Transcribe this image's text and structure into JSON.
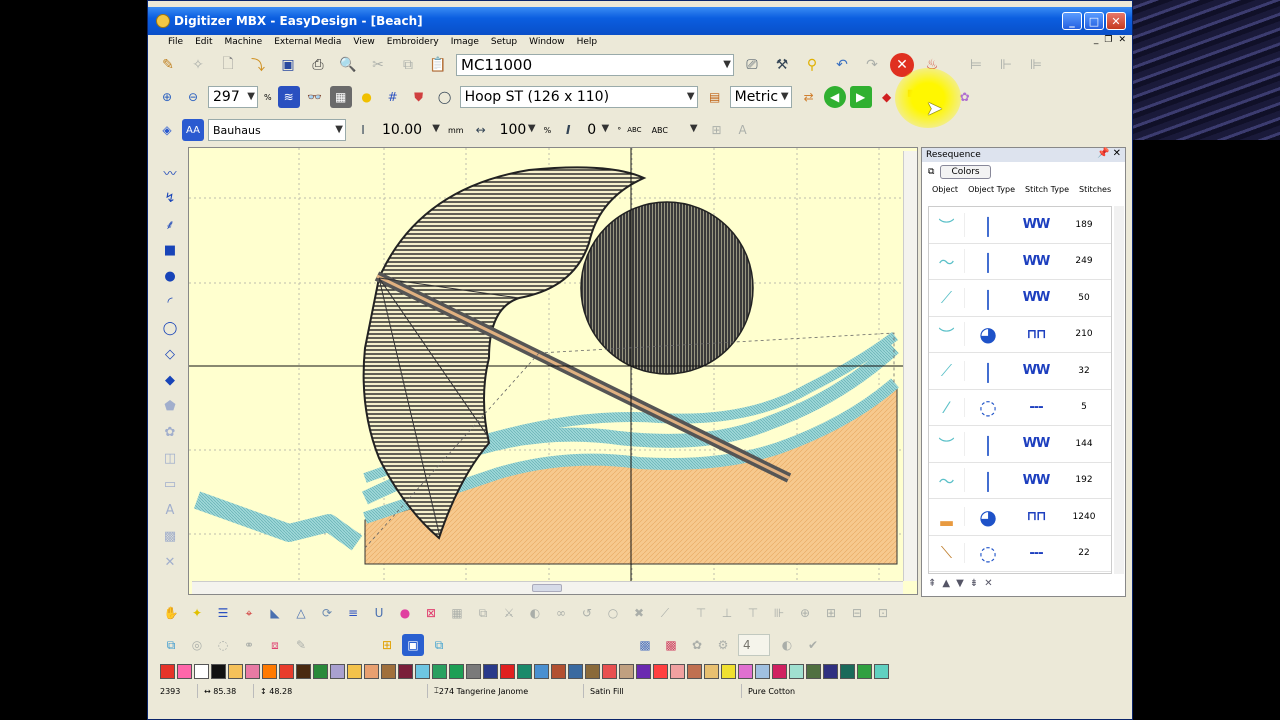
{
  "window": {
    "title": "Digitizer MBX - EasyDesign - [Beach]"
  },
  "menu": [
    "File",
    "Edit",
    "Machine",
    "External Media",
    "View",
    "Embroidery",
    "Image",
    "Setup",
    "Window",
    "Help"
  ],
  "toolbar1": {
    "machine": "MC11000"
  },
  "toolbar2": {
    "zoom": "297",
    "zoom_unit": "%",
    "hoop": "Hoop ST (126 x 110)",
    "units": "Metric"
  },
  "toolbar3": {
    "font": "Bauhaus",
    "height": "10.00",
    "height_unit": "mm",
    "width": "100",
    "width_unit": "%",
    "slant": "0",
    "slant_unit": "°",
    "abc1": "ABC",
    "abc2": "ABC"
  },
  "resequence": {
    "title": "Resequence",
    "colors_label": "Colors",
    "columns": [
      "Object",
      "Object Type",
      "Stitch Type",
      "Stitches"
    ],
    "rows": [
      {
        "stitches": "189"
      },
      {
        "stitches": "249"
      },
      {
        "stitches": "50"
      },
      {
        "stitches": "210"
      },
      {
        "stitches": "32"
      },
      {
        "stitches": "5"
      },
      {
        "stitches": "144"
      },
      {
        "stitches": "192"
      },
      {
        "stitches": "1240"
      },
      {
        "stitches": "22"
      }
    ]
  },
  "status": {
    "stitch_count": "2393",
    "width": "85.38",
    "height": "48.28",
    "thread": "274 Tangerine Janome",
    "fill": "Satin Fill",
    "material": "Pure Cotton"
  },
  "toolbar4": {
    "spin_value": "4"
  },
  "palette": [
    "#e63329",
    "#ff66aa",
    "#ffffff",
    "#111111",
    "#f5c15a",
    "#e87aa4",
    "#ff7a00",
    "#e83c2c",
    "#4a2a10",
    "#2a8a3a",
    "#a9a0d0",
    "#f3c24b",
    "#e8a070",
    "#a0703c",
    "#7a1f3a",
    "#6ec6e2",
    "#2aa060",
    "#1e9f55",
    "#7a7a7a",
    "#2a3a8a",
    "#e02020",
    "#1a8a6a",
    "#4a90d0",
    "#b25030",
    "#3a6aa0",
    "#8a6a3a",
    "#e85050",
    "#c0a080",
    "#6a2ab0",
    "#ff4040",
    "#f0a0a0",
    "#c07050",
    "#e8c070",
    "#f0e030",
    "#e070d0",
    "#a0c0e0",
    "#d02060",
    "#a0e0d0",
    "#507040",
    "#303080",
    "#1a6a5a",
    "#30a040",
    "#60d0c0"
  ]
}
